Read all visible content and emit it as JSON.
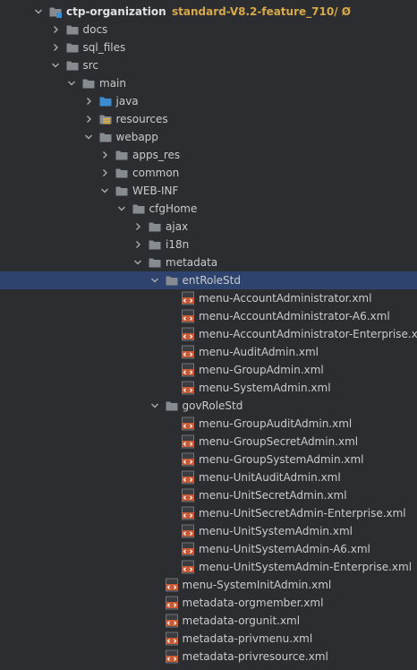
{
  "tree": {
    "rows": [
      {
        "label": "ctp-organization",
        "branch": "standard-V8.2-feature_710/ Ø",
        "level": 0,
        "expand": "open",
        "icon": "module-folder-icon",
        "bold": true
      },
      {
        "label": "docs",
        "level": 1,
        "expand": "closed",
        "icon": "folder-icon"
      },
      {
        "label": "sql_files",
        "level": 1,
        "expand": "closed",
        "icon": "folder-icon"
      },
      {
        "label": "src",
        "level": 1,
        "expand": "open",
        "icon": "folder-icon"
      },
      {
        "label": "main",
        "level": 2,
        "expand": "open",
        "icon": "folder-icon"
      },
      {
        "label": "java",
        "level": 3,
        "expand": "closed",
        "icon": "source-folder-icon"
      },
      {
        "label": "resources",
        "level": 3,
        "expand": "closed",
        "icon": "resources-folder-icon"
      },
      {
        "label": "webapp",
        "level": 3,
        "expand": "open",
        "icon": "folder-icon"
      },
      {
        "label": "apps_res",
        "level": 4,
        "expand": "closed",
        "icon": "folder-icon"
      },
      {
        "label": "common",
        "level": 4,
        "expand": "closed",
        "icon": "folder-icon"
      },
      {
        "label": "WEB-INF",
        "level": 4,
        "expand": "open",
        "icon": "folder-icon"
      },
      {
        "label": "cfgHome",
        "level": 5,
        "expand": "open",
        "icon": "folder-icon"
      },
      {
        "label": "ajax",
        "level": 6,
        "expand": "closed",
        "icon": "folder-icon"
      },
      {
        "label": "i18n",
        "level": 6,
        "expand": "closed",
        "icon": "folder-icon"
      },
      {
        "label": "metadata",
        "level": 6,
        "expand": "open",
        "icon": "folder-icon"
      },
      {
        "label": "entRoleStd",
        "level": 7,
        "expand": "open",
        "icon": "folder-icon",
        "selected": true
      },
      {
        "label": "menu-AccountAdministrator.xml",
        "level": 8,
        "expand": "none",
        "icon": "xml-file-icon"
      },
      {
        "label": "menu-AccountAdministrator-A6.xml",
        "level": 8,
        "expand": "none",
        "icon": "xml-file-icon"
      },
      {
        "label": "menu-AccountAdministrator-Enterprise.xml",
        "level": 8,
        "expand": "none",
        "icon": "xml-file-icon"
      },
      {
        "label": "menu-AuditAdmin.xml",
        "level": 8,
        "expand": "none",
        "icon": "xml-file-icon"
      },
      {
        "label": "menu-GroupAdmin.xml",
        "level": 8,
        "expand": "none",
        "icon": "xml-file-icon"
      },
      {
        "label": "menu-SystemAdmin.xml",
        "level": 8,
        "expand": "none",
        "icon": "xml-file-icon"
      },
      {
        "label": "govRoleStd",
        "level": 7,
        "expand": "open",
        "icon": "folder-icon"
      },
      {
        "label": "menu-GroupAuditAdmin.xml",
        "level": 8,
        "expand": "none",
        "icon": "xml-file-icon"
      },
      {
        "label": "menu-GroupSecretAdmin.xml",
        "level": 8,
        "expand": "none",
        "icon": "xml-file-icon"
      },
      {
        "label": "menu-GroupSystemAdmin.xml",
        "level": 8,
        "expand": "none",
        "icon": "xml-file-icon"
      },
      {
        "label": "menu-UnitAuditAdmin.xml",
        "level": 8,
        "expand": "none",
        "icon": "xml-file-icon"
      },
      {
        "label": "menu-UnitSecretAdmin.xml",
        "level": 8,
        "expand": "none",
        "icon": "xml-file-icon"
      },
      {
        "label": "menu-UnitSecretAdmin-Enterprise.xml",
        "level": 8,
        "expand": "none",
        "icon": "xml-file-icon"
      },
      {
        "label": "menu-UnitSystemAdmin.xml",
        "level": 8,
        "expand": "none",
        "icon": "xml-file-icon"
      },
      {
        "label": "menu-UnitSystemAdmin-A6.xml",
        "level": 8,
        "expand": "none",
        "icon": "xml-file-icon"
      },
      {
        "label": "menu-UnitSystemAdmin-Enterprise.xml",
        "level": 8,
        "expand": "none",
        "icon": "xml-file-icon"
      },
      {
        "label": "menu-SystemInitAdmin.xml",
        "level": 7,
        "expand": "none",
        "icon": "xml-file-icon"
      },
      {
        "label": "metadata-orgmember.xml",
        "level": 7,
        "expand": "none",
        "icon": "xml-file-icon"
      },
      {
        "label": "metadata-orgunit.xml",
        "level": 7,
        "expand": "none",
        "icon": "xml-file-icon"
      },
      {
        "label": "metadata-privmenu.xml",
        "level": 7,
        "expand": "none",
        "icon": "xml-file-icon"
      },
      {
        "label": "metadata-privresource.xml",
        "level": 7,
        "expand": "none",
        "icon": "xml-file-icon"
      }
    ]
  },
  "colors": {
    "background": "#2b2d30",
    "selection": "#2e436e",
    "text": "#c9cbcf",
    "branch": "#d8a94a",
    "folder": "#868a91",
    "source_folder": "#3d8bd1",
    "xml_icon": "#c75a34"
  }
}
